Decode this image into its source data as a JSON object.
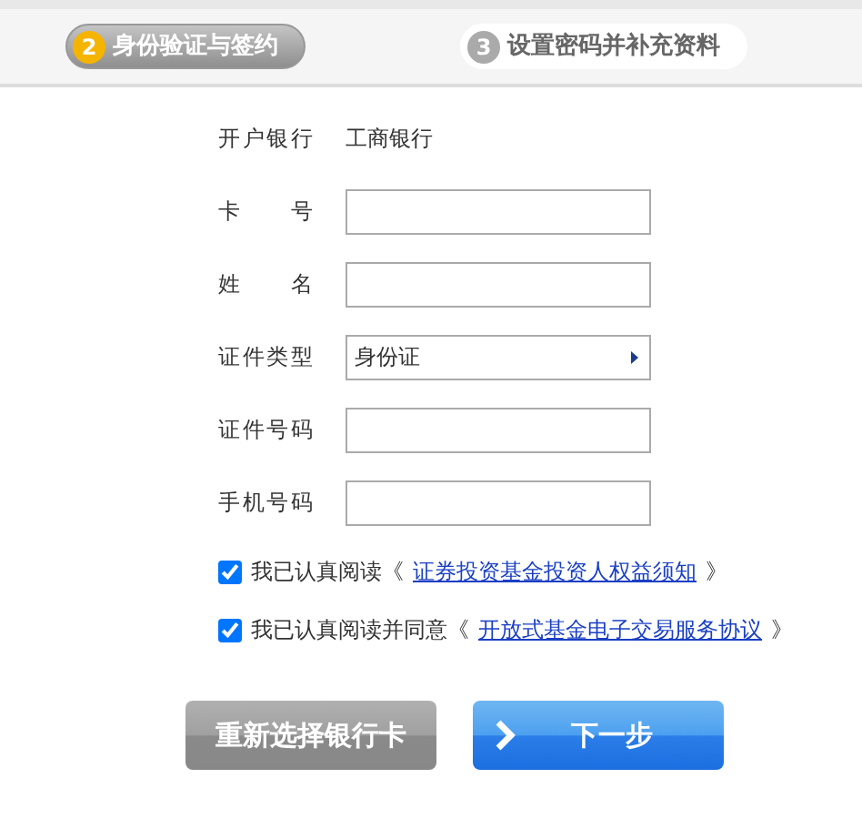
{
  "steps": [
    {
      "number": "2",
      "label": "身份验证与签约",
      "selected": true
    },
    {
      "number": "3",
      "label": "设置密码并补充资料",
      "selected": false
    }
  ],
  "form": [
    {
      "kind": "text",
      "label": "开户银行",
      "value": "工商银行"
    },
    {
      "kind": "input",
      "label": "卡号"
    },
    {
      "kind": "input",
      "label": "姓名"
    },
    {
      "kind": "select",
      "label": "证件类型",
      "value": "身份证"
    },
    {
      "kind": "input",
      "label": "证件号码"
    },
    {
      "kind": "input",
      "label": "手机号码"
    }
  ],
  "agreements": [
    {
      "checked": true,
      "text": "我已认真阅读《",
      "link": "证券投资基金投资人权益须知",
      "suffix": "》"
    },
    {
      "checked": true,
      "text": "我已认真阅读并同意《",
      "link": "开放式基金电子交易服务协议",
      "suffix": "》"
    }
  ],
  "buttons": [
    {
      "kind": "secondary",
      "label": "重新选择银行卡"
    },
    {
      "kind": "primary",
      "label": "下一步"
    }
  ]
}
